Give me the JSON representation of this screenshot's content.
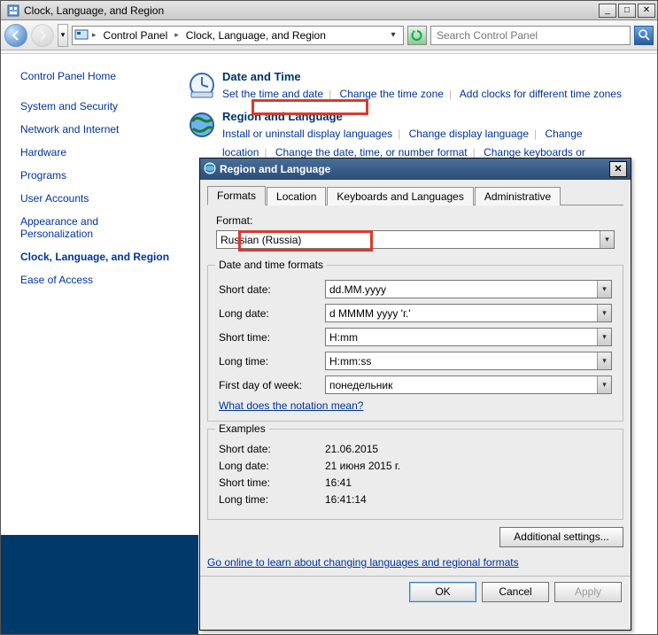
{
  "window": {
    "title": "Clock, Language, and Region"
  },
  "address": {
    "crumb1": "Control Panel",
    "crumb2": "Clock, Language, and Region"
  },
  "search": {
    "placeholder": "Search Control Panel"
  },
  "sidebar": {
    "home": "Control Panel Home",
    "items": [
      "System and Security",
      "Network and Internet",
      "Hardware",
      "Programs",
      "User Accounts",
      "Appearance and Personalization",
      "Clock, Language, and Region",
      "Ease of Access"
    ]
  },
  "main": {
    "cat1": {
      "title": "Date and Time",
      "links": [
        "Set the time and date",
        "Change the time zone",
        "Add clocks for different time zones"
      ]
    },
    "cat2": {
      "title": "Region and Language",
      "links": [
        "Install or uninstall display languages",
        "Change display language",
        "Change location",
        "Change the date, time, or number format",
        "Change keyboards or other input methods"
      ]
    }
  },
  "dialog": {
    "title": "Region and Language",
    "tabs": [
      "Formats",
      "Location",
      "Keyboards and Languages",
      "Administrative"
    ],
    "format_label": "Format:",
    "format_value": "Russian (Russia)",
    "group_dt": "Date and time formats",
    "rows": {
      "short_date_label": "Short date:",
      "short_date_value": "dd.MM.yyyy",
      "long_date_label": "Long date:",
      "long_date_value": "d MMMM yyyy 'г.'",
      "short_time_label": "Short time:",
      "short_time_value": "H:mm",
      "long_time_label": "Long time:",
      "long_time_value": "H:mm:ss",
      "first_day_label": "First day of week:",
      "first_day_value": "понедельник"
    },
    "notation_link": "What does the notation mean?",
    "group_ex": "Examples",
    "examples": {
      "short_date_label": "Short date:",
      "short_date_value": "21.06.2015",
      "long_date_label": "Long date:",
      "long_date_value": "21 июня 2015 г.",
      "short_time_label": "Short time:",
      "short_time_value": "16:41",
      "long_time_label": "Long time:",
      "long_time_value": "16:41:14"
    },
    "additional": "Additional settings...",
    "online_link": "Go online to learn about changing languages and regional formats",
    "buttons": {
      "ok": "OK",
      "cancel": "Cancel",
      "apply": "Apply"
    }
  }
}
